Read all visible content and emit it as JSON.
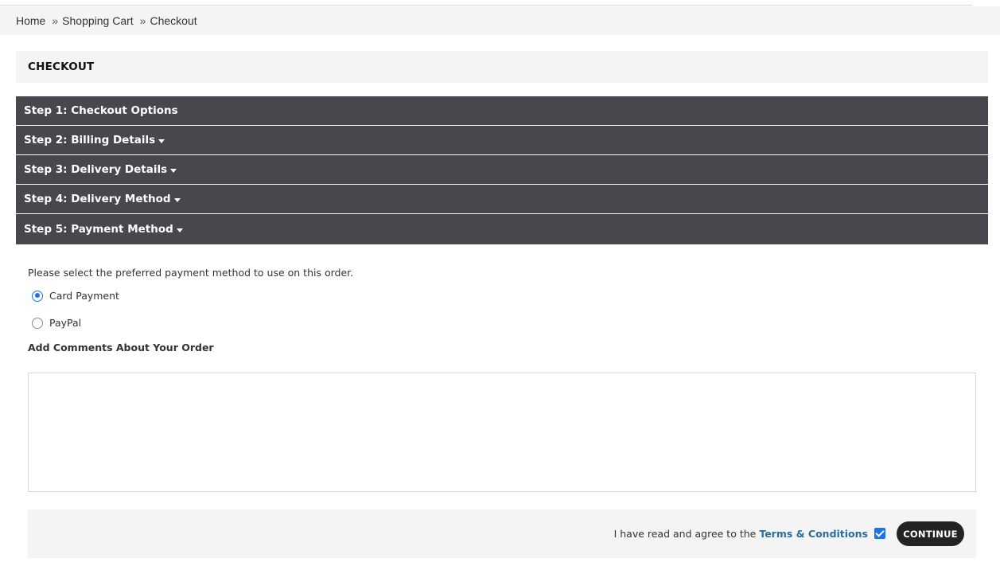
{
  "breadcrumb": {
    "items": [
      "Home",
      "Shopping Cart",
      "Checkout"
    ],
    "separator": "»"
  },
  "page_title": "CHECKOUT",
  "steps": [
    {
      "label": "Step 1: Checkout Options",
      "has_caret": false
    },
    {
      "label": "Step 2: Billing Details",
      "has_caret": true
    },
    {
      "label": "Step 3: Delivery Details",
      "has_caret": true
    },
    {
      "label": "Step 4: Delivery Method",
      "has_caret": true
    },
    {
      "label": "Step 5: Payment Method",
      "has_caret": true
    }
  ],
  "payment": {
    "instruction": "Please select the preferred payment method to use on this order.",
    "options": [
      {
        "label": "Card Payment",
        "selected": true
      },
      {
        "label": "PayPal",
        "selected": false
      }
    ],
    "comments_label": "Add Comments About Your Order",
    "comments_value": ""
  },
  "footer": {
    "agree_text": "I have read and agree to the",
    "terms_link": "Terms & Conditions",
    "agree_checked": true,
    "continue_label": "CONTINUE"
  },
  "colors": {
    "step_bg": "#48474d",
    "accent_blue": "#1a73e8",
    "link": "#2b6c9b",
    "button_bg": "#232326",
    "panel_bg": "#f4f4f4"
  }
}
